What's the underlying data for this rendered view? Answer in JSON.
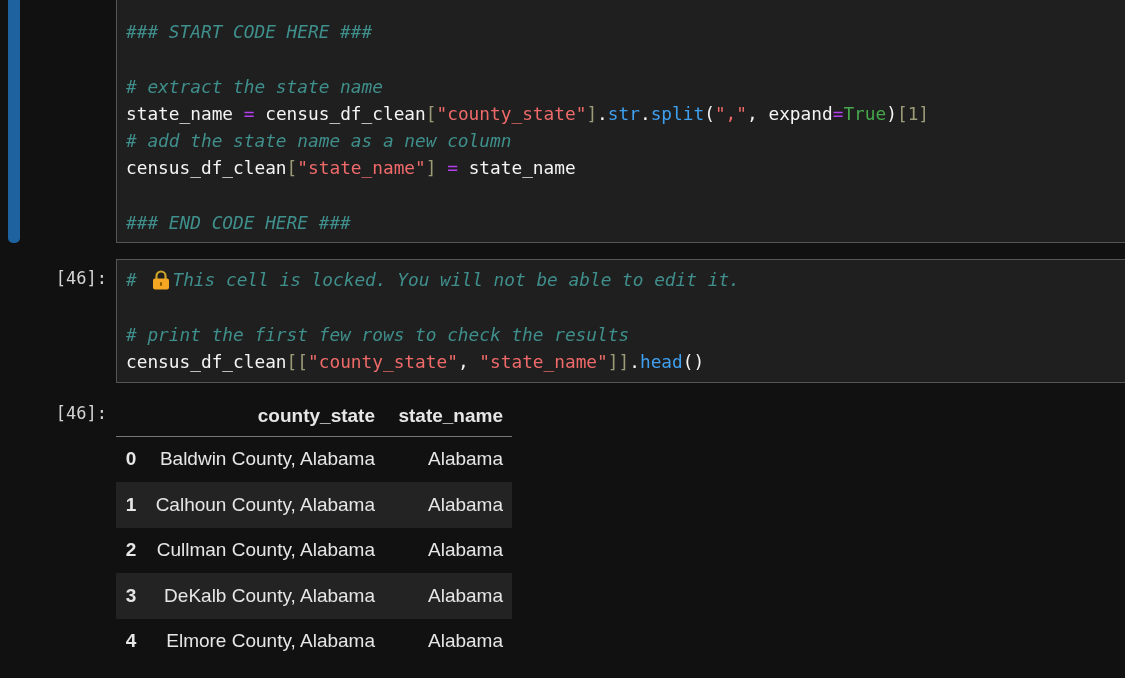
{
  "cells": [
    {
      "selected": true,
      "lines": [
        {
          "kind": "code",
          "tokens": [
            {
              "kind": "comment",
              "text": "### START CODE HERE ###"
            }
          ]
        },
        {
          "kind": "blank"
        },
        {
          "kind": "code",
          "tokens": [
            {
              "kind": "comment",
              "text": "# extract the state name"
            }
          ]
        },
        {
          "kind": "code",
          "tokens": [
            {
              "kind": "name",
              "text": "state_name "
            },
            {
              "kind": "op",
              "text": "="
            },
            {
              "kind": "name",
              "text": " census_df_clean"
            },
            {
              "kind": "bracket",
              "text": "["
            },
            {
              "kind": "string",
              "text": "\"county_state\""
            },
            {
              "kind": "bracket",
              "text": "]"
            },
            {
              "kind": "name",
              "text": "."
            },
            {
              "kind": "func",
              "text": "str"
            },
            {
              "kind": "name",
              "text": "."
            },
            {
              "kind": "func",
              "text": "split"
            },
            {
              "kind": "name",
              "text": "("
            },
            {
              "kind": "string",
              "text": "\",\""
            },
            {
              "kind": "name",
              "text": ", expand"
            },
            {
              "kind": "op",
              "text": "="
            },
            {
              "kind": "keyword",
              "text": "True"
            },
            {
              "kind": "name",
              "text": ")"
            },
            {
              "kind": "bracket",
              "text": "[1]"
            }
          ]
        },
        {
          "kind": "code",
          "tokens": [
            {
              "kind": "comment",
              "text": "# add the state name as a new column"
            }
          ]
        },
        {
          "kind": "code",
          "tokens": [
            {
              "kind": "name",
              "text": "census_df_clean"
            },
            {
              "kind": "bracket",
              "text": "["
            },
            {
              "kind": "string",
              "text": "\"state_name\""
            },
            {
              "kind": "bracket",
              "text": "]"
            },
            {
              "kind": "op",
              "text": " ="
            },
            {
              "kind": "name",
              "text": " state_name"
            }
          ]
        },
        {
          "kind": "blank"
        },
        {
          "kind": "code",
          "tokens": [
            {
              "kind": "comment",
              "text": "### END CODE HERE ###"
            }
          ]
        }
      ]
    },
    {
      "selected": false,
      "prompt": "[46]:",
      "lines": [
        {
          "kind": "code",
          "tokens": [
            {
              "kind": "comment",
              "text": "# "
            },
            {
              "kind": "lock"
            },
            {
              "kind": "comment",
              "text": "This cell is locked. You will not be able to edit it."
            }
          ]
        },
        {
          "kind": "blank"
        },
        {
          "kind": "code",
          "tokens": [
            {
              "kind": "comment",
              "text": "# print the first few rows to check the results"
            }
          ]
        },
        {
          "kind": "code",
          "tokens": [
            {
              "kind": "name",
              "text": "census_df_clean"
            },
            {
              "kind": "bracket",
              "text": "[["
            },
            {
              "kind": "string",
              "text": "\"county_state\""
            },
            {
              "kind": "name",
              "text": ", "
            },
            {
              "kind": "string",
              "text": "\"state_name\""
            },
            {
              "kind": "bracket",
              "text": "]]"
            },
            {
              "kind": "name",
              "text": "."
            },
            {
              "kind": "func",
              "text": "head"
            },
            {
              "kind": "name",
              "text": "()"
            }
          ]
        }
      ]
    }
  ],
  "output": {
    "prompt": "[46]:",
    "table": {
      "columns": [
        "county_state",
        "state_name"
      ],
      "rows": [
        {
          "index": "0",
          "cells": [
            "Baldwin County, Alabama",
            "Alabama"
          ]
        },
        {
          "index": "1",
          "cells": [
            "Calhoun County, Alabama",
            "Alabama"
          ]
        },
        {
          "index": "2",
          "cells": [
            "Cullman County, Alabama",
            "Alabama"
          ]
        },
        {
          "index": "3",
          "cells": [
            "DeKalb County, Alabama",
            "Alabama"
          ]
        },
        {
          "index": "4",
          "cells": [
            "Elmore County, Alabama",
            "Alabama"
          ]
        }
      ]
    }
  }
}
